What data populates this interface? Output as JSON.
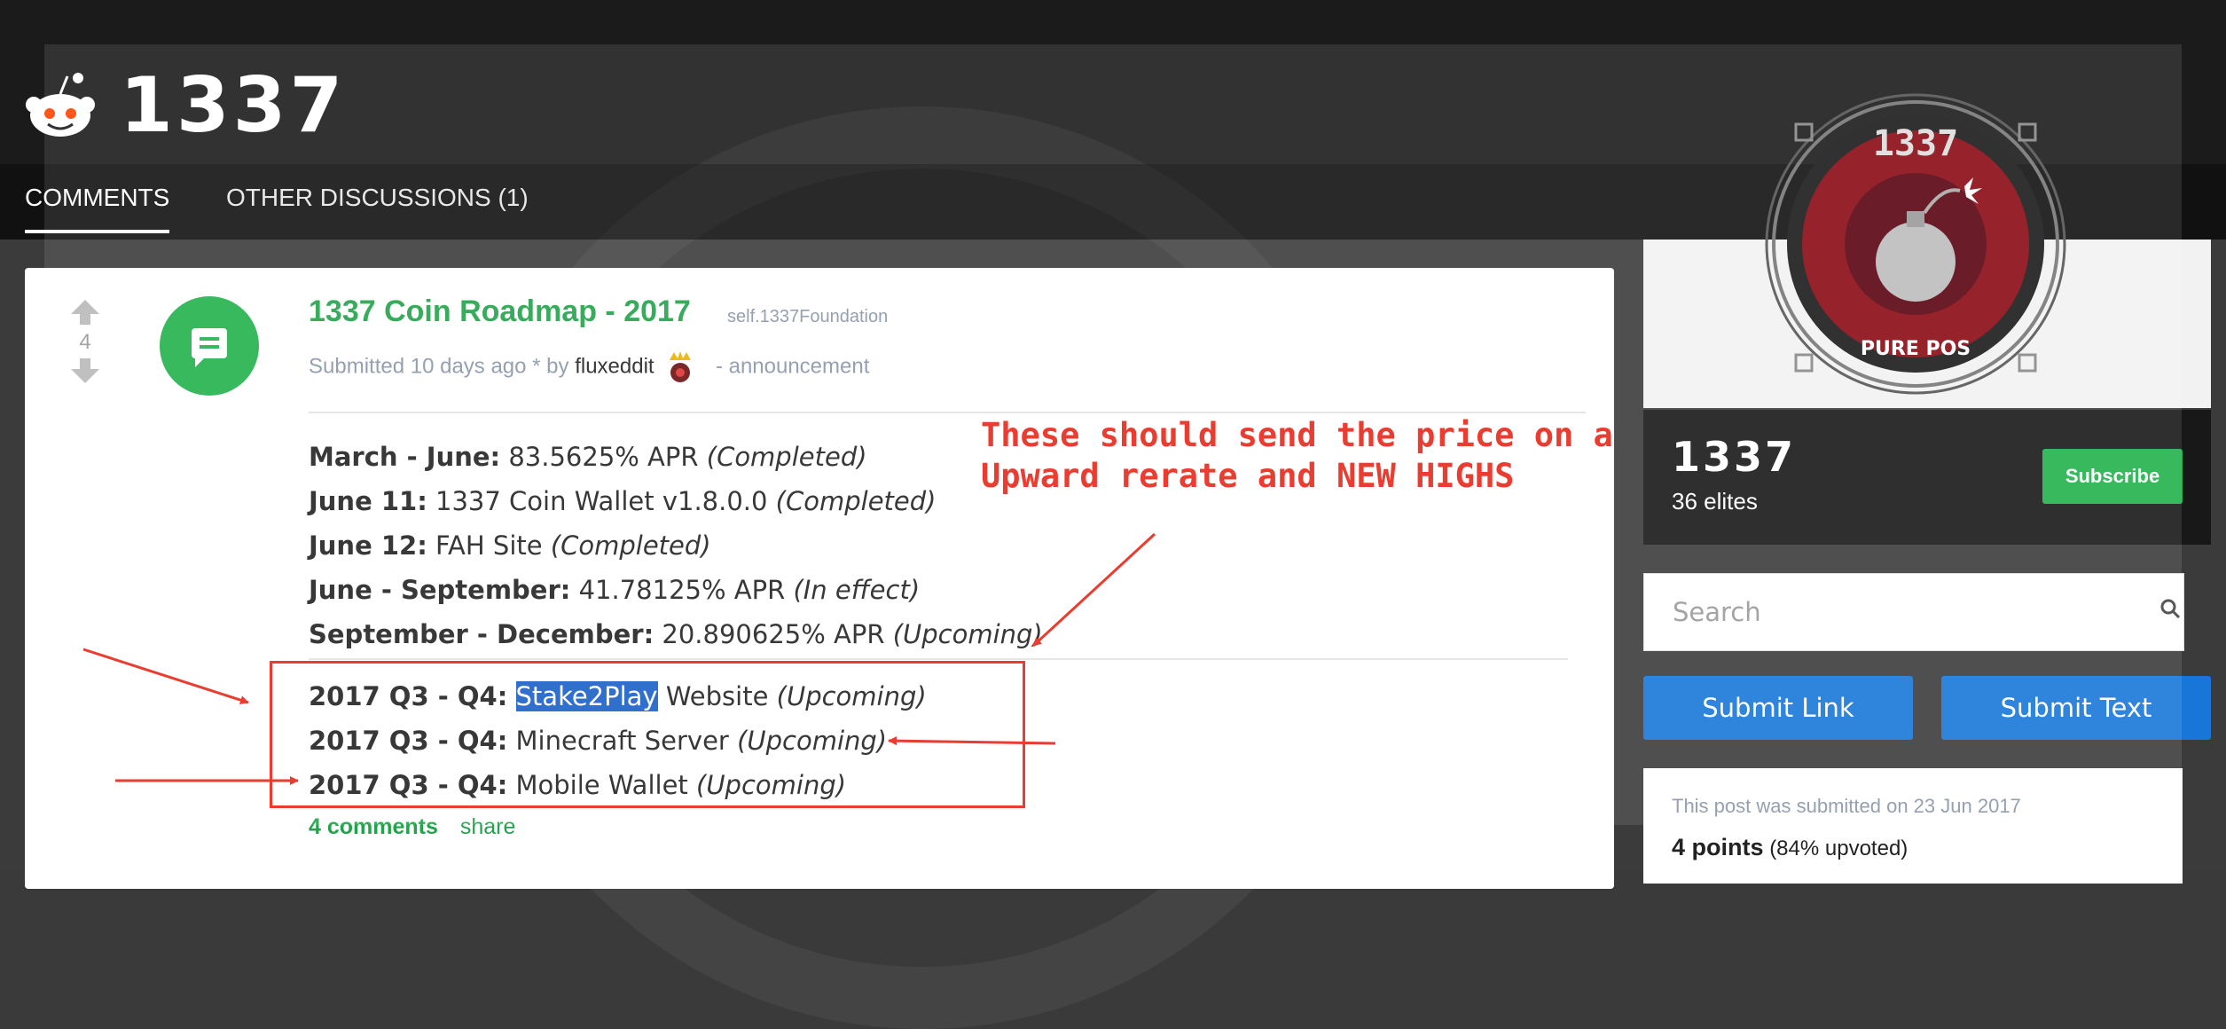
{
  "brand": {
    "logo_text": "1337",
    "accent": "#22b14c"
  },
  "tabs": [
    {
      "label": "COMMENTS",
      "active": true
    },
    {
      "label": "OTHER DISCUSSIONS (1)",
      "active": false
    }
  ],
  "post": {
    "score": "4",
    "title": "1337 Coin Roadmap - 2017",
    "domain": "self.1337Foundation",
    "submitted_prefix": "Submitted 10 days ago * by",
    "author": "fluxeddit",
    "flair": "- announcement",
    "lines": [
      {
        "label": "March - June:",
        "text": " 83.5625% APR ",
        "status": "(Completed)"
      },
      {
        "label": "June 11:",
        "text": " 1337 Coin Wallet v1.8.0.0 ",
        "status": "(Completed)"
      },
      {
        "label": "June 12:",
        "text": " FAH Site ",
        "status": "(Completed)"
      },
      {
        "label": "June - September:",
        "text": " 41.78125% APR ",
        "status": "(In effect)"
      },
      {
        "label": "September - December:",
        "text": " 20.890625% APR ",
        "status": "(Upcoming)"
      }
    ],
    "lines2": [
      {
        "label": "2017 Q3 - Q4:",
        "selected": "Stake2Play",
        "text": " Website ",
        "status": "(Upcoming)"
      },
      {
        "label": "2017 Q3 - Q4:",
        "text": " Minecraft Server ",
        "status": "(Upcoming)"
      },
      {
        "label": "2017 Q3 - Q4:",
        "text": " Mobile Wallet ",
        "status": "(Upcoming)"
      }
    ],
    "comments_link": "4 comments",
    "share_link": "share"
  },
  "annotation": {
    "line1": "These should send the price on a",
    "line2": "Upward rerate and NEW HIGHS",
    "color": "#e8281a"
  },
  "sidebar": {
    "emblem_top": "1337",
    "emblem_bottom": "PURE POS",
    "name": "1337",
    "members": "36 elites",
    "subscribe_label": "Subscribe",
    "search_placeholder": "Search",
    "submit_link_label": "Submit Link",
    "submit_text_label": "Submit Text",
    "submitted_on": "This post was submitted on 23 Jun 2017",
    "points": "4 points",
    "upvoted": "(84% upvoted)"
  }
}
